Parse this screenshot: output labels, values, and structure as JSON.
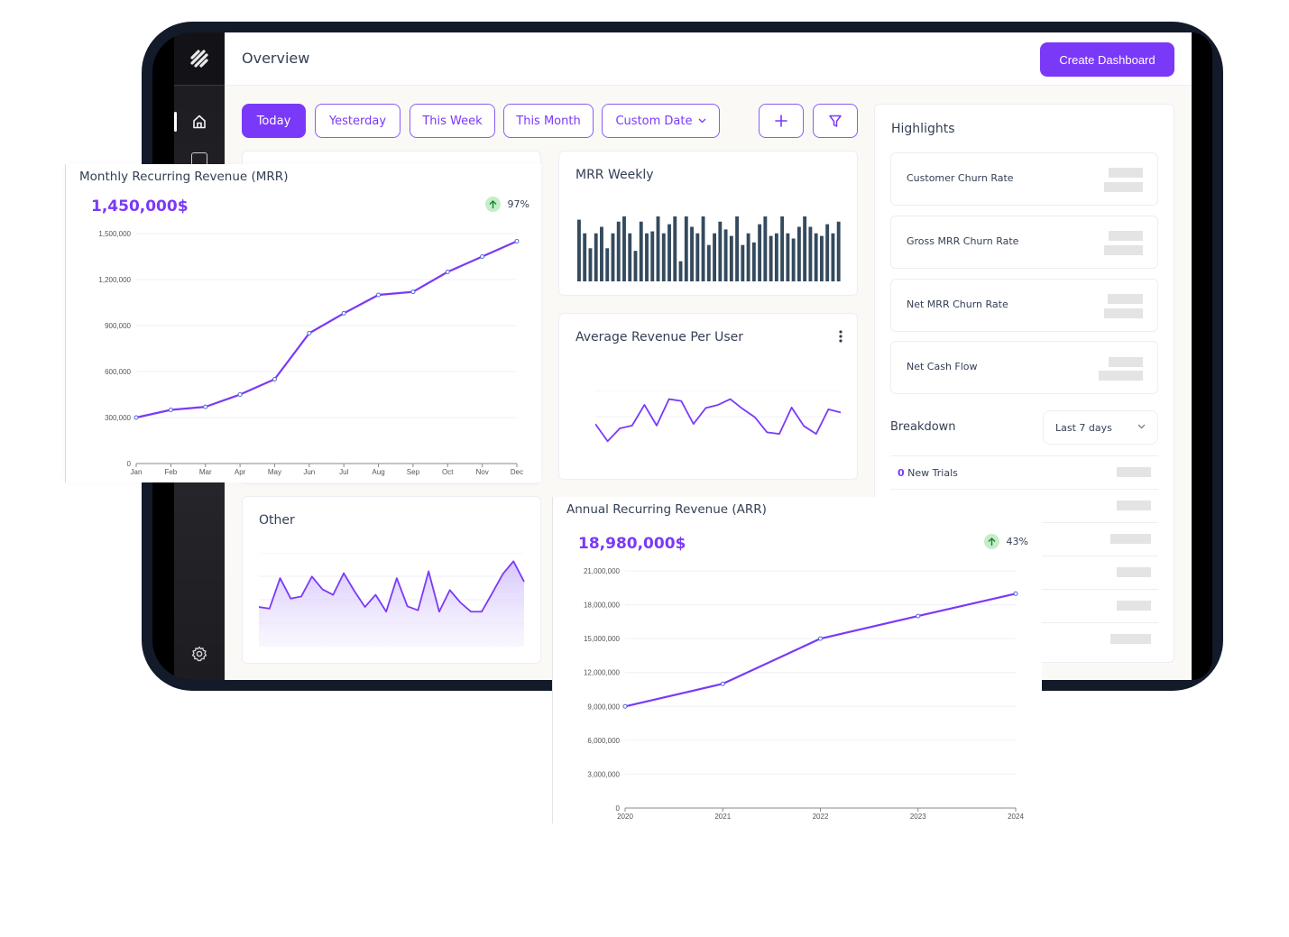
{
  "header": {
    "title": "Overview",
    "create_button": "Create Dashboard"
  },
  "sidebar": {
    "items": [
      {
        "icon": "home-icon",
        "active": true
      },
      {
        "icon": "square-icon",
        "active": false
      },
      {
        "icon": "gear-icon",
        "active": false
      }
    ]
  },
  "date_filters": [
    {
      "label": "Today",
      "active": true
    },
    {
      "label": "Yesterday",
      "active": false
    },
    {
      "label": "This Week",
      "active": false
    },
    {
      "label": "This Month",
      "active": false
    },
    {
      "label": "Custom Date",
      "active": false,
      "dropdown": true
    }
  ],
  "toolbar": {
    "add_icon": "plus-icon",
    "filter_icon": "funnel-icon"
  },
  "colors": {
    "accent": "#7a39f8",
    "bar": "#344a5e",
    "positive_badge": "#c6ecc9",
    "positive_arrow": "#168a2c",
    "skeleton": "#e4e4e4"
  },
  "mrr_weekly": {
    "title": "MRR Weekly"
  },
  "arpu": {
    "title": "Average Revenue Per User",
    "menu_icon": "kebab-icon"
  },
  "other": {
    "title": "Other"
  },
  "mrr": {
    "title": "Monthly Recurring Revenue (MRR)",
    "value": "1,450,000$",
    "change": "97%",
    "trend": "up"
  },
  "arr": {
    "title": "Annual Recurring Revenue (ARR)",
    "value": "18,980,000$",
    "change": "43%",
    "trend": "up"
  },
  "highlights": {
    "title": "Highlights",
    "items": [
      {
        "label": "Customer Churn Rate"
      },
      {
        "label": "Gross MRR Churn Rate"
      },
      {
        "label": "Net MRR Churn Rate"
      },
      {
        "label": "Net Cash Flow"
      }
    ]
  },
  "breakdown": {
    "title": "Breakdown",
    "range_selected": "Last 7 days",
    "rows": [
      {
        "count": "0",
        "label": "New Trials"
      }
    ]
  },
  "chart_data": [
    {
      "id": "mrr",
      "type": "line",
      "title": "Monthly Recurring Revenue (MRR)",
      "categories": [
        "Jan",
        "Feb",
        "Mar",
        "Apr",
        "May",
        "Jun",
        "Jul",
        "Aug",
        "Sep",
        "Oct",
        "Nov",
        "Dec"
      ],
      "values": [
        300000,
        350000,
        370000,
        450000,
        550000,
        850000,
        980000,
        1100000,
        1120000,
        1250000,
        1350000,
        1450000
      ],
      "ylim": [
        0,
        1500000
      ],
      "yticks": [
        0,
        300000,
        600000,
        900000,
        1200000,
        1500000
      ],
      "ytick_labels": [
        "0",
        "300,000",
        "600,000",
        "900,000",
        "1,200,000",
        "1,500,000"
      ],
      "grid": true,
      "xlabel": "",
      "ylabel": ""
    },
    {
      "id": "mrr_weekly",
      "type": "bar",
      "title": "MRR Weekly",
      "values": [
        95,
        74,
        51,
        74,
        84,
        51,
        74,
        92,
        100,
        74,
        47,
        92,
        74,
        77,
        100,
        74,
        88,
        100,
        31,
        100,
        84,
        74,
        100,
        56,
        74,
        92,
        80,
        70,
        100,
        56,
        74,
        60,
        88,
        100,
        70,
        74,
        100,
        74,
        66,
        84,
        100,
        84,
        74,
        70,
        88,
        74,
        92
      ],
      "ylim": [
        0,
        100
      ]
    },
    {
      "id": "arpu",
      "type": "line",
      "title": "Average Revenue Per User",
      "values": [
        0.72,
        0.06,
        0.55,
        0.66,
        1.45,
        0.66,
        1.67,
        1.6,
        0.72,
        1.33,
        1.45,
        1.67,
        1.3,
        0.98,
        0.4,
        0.34,
        1.35,
        0.64,
        0.34,
        1.28,
        1.16
      ],
      "ylim": [
        0,
        2
      ],
      "grid": true
    },
    {
      "id": "other",
      "type": "area",
      "title": "Other",
      "values": [
        1.69,
        1.62,
        2.92,
        2.05,
        2.14,
        2.99,
        2.44,
        2.21,
        3.13,
        2.37,
        1.69,
        2.21,
        1.49,
        2.92,
        1.72,
        1.55,
        3.21,
        1.49,
        2.41,
        1.88,
        1.49,
        1.49,
        2.28,
        3.1,
        3.64,
        2.77
      ],
      "ylim": [
        0,
        4
      ],
      "grid": true
    },
    {
      "id": "arr",
      "type": "line",
      "title": "Annual Recurring Revenue (ARR)",
      "categories": [
        "2020",
        "2021",
        "2022",
        "2023",
        "2024"
      ],
      "values": [
        9000000,
        11000000,
        15000000,
        17000000,
        18980000
      ],
      "ylim": [
        0,
        21000000
      ],
      "yticks": [
        0,
        3000000,
        6000000,
        9000000,
        12000000,
        15000000,
        18000000,
        21000000
      ],
      "ytick_labels": [
        "0",
        "3,000,000",
        "6,000,000",
        "9,000,000",
        "12,000,000",
        "15,000,000",
        "18,000,000",
        "21,000,000"
      ],
      "grid": true,
      "xlabel": "",
      "ylabel": ""
    }
  ]
}
